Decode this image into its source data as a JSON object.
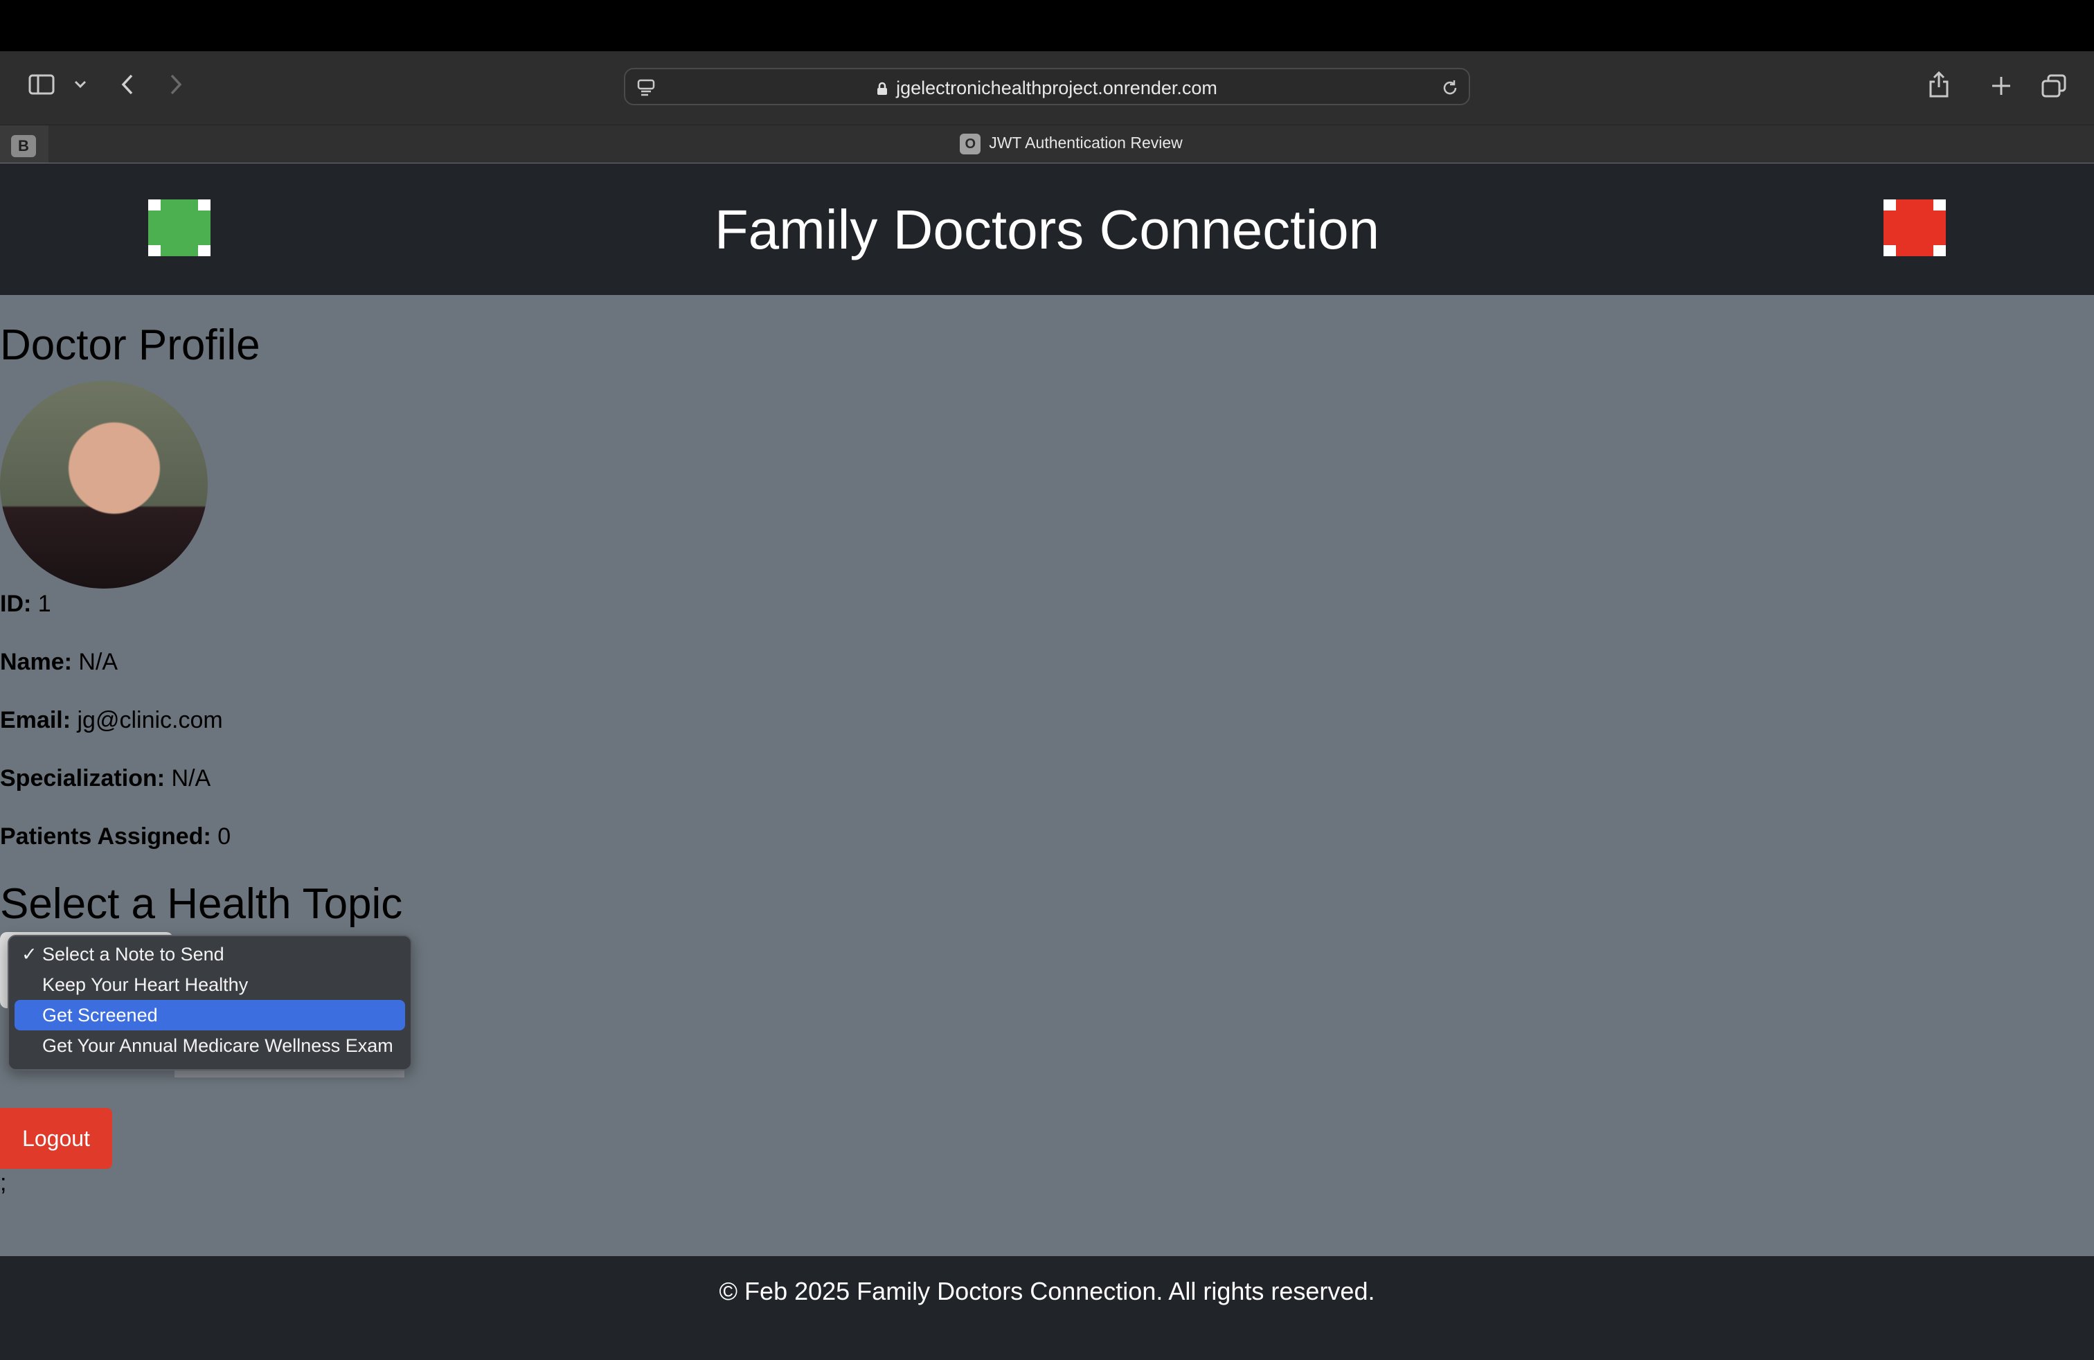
{
  "browser": {
    "url": "jgelectronichealthproject.onrender.com",
    "tab_group_letter": "B",
    "tab": {
      "favicon_letter": "O",
      "title": "JWT Authentication Review"
    },
    "icons": [
      "sidebar-icon",
      "chevron-down-icon",
      "back-icon",
      "forward-icon",
      "page-menu-icon",
      "lock-icon",
      "reload-icon",
      "share-icon",
      "new-tab-icon",
      "tab-overview-icon"
    ]
  },
  "header": {
    "title": "Family Doctors Connection",
    "logo_left_color": "#4caf50",
    "logo_right_color": "#e53224"
  },
  "profile": {
    "heading": "Doctor Profile",
    "fields": [
      {
        "label": "ID:",
        "value": "1"
      },
      {
        "label": "Name:",
        "value": "N/A"
      },
      {
        "label": "Email:",
        "value": "jg@clinic.com"
      },
      {
        "label": "Specialization:",
        "value": "N/A"
      },
      {
        "label": "Patients Assigned:",
        "value": "0"
      }
    ]
  },
  "health_topic": {
    "heading": "Select a Health Topic",
    "options": [
      {
        "label": "Select a Note to Send",
        "checked": true
      },
      {
        "label": "Keep Your Heart Healthy"
      },
      {
        "label": "Get Screened",
        "highlighted": true
      },
      {
        "label": "Get Your Annual Medicare Wellness Exam"
      }
    ],
    "check_glyph": "✓"
  },
  "actions": {
    "logout_label": "Logout",
    "stray_text": ";"
  },
  "footer": {
    "text": "© Feb 2025 Family Doctors Connection. All rights reserved."
  },
  "colors": {
    "page_bg": "#6c757d",
    "bar_bg": "#212529",
    "logout_bg": "#e03a2a",
    "highlight": "#3d6ee0"
  }
}
